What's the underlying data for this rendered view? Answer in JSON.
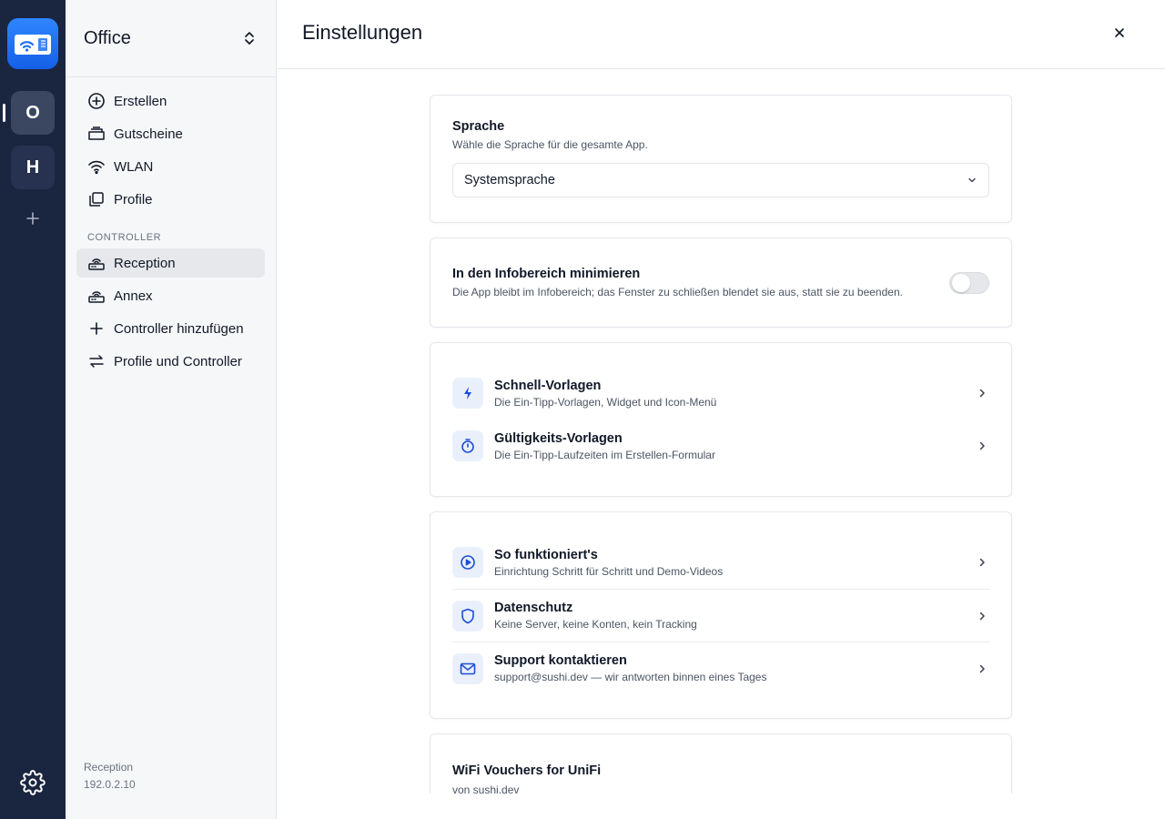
{
  "rail": {
    "workspaces": [
      {
        "letter": "O",
        "active": true
      },
      {
        "letter": "H",
        "active": false
      }
    ],
    "add_icon": "plus-icon",
    "settings_icon": "gear-icon",
    "logo_icon": "wifi-ticket-icon",
    "colors": {
      "background": "#1a2540",
      "logo": "#1f72f5"
    }
  },
  "sidebar": {
    "workspace_name": "Office",
    "nav": [
      {
        "label": "Erstellen",
        "icon": "plus-circle-icon"
      },
      {
        "label": "Gutscheine",
        "icon": "tickets-icon"
      },
      {
        "label": "WLAN",
        "icon": "wifi-icon"
      },
      {
        "label": "Profile",
        "icon": "copy-icon"
      }
    ],
    "controller_section_label": "CONTROLLER",
    "controllers": [
      {
        "label": "Reception",
        "icon": "router-icon",
        "active": true
      },
      {
        "label": "Annex",
        "icon": "router-icon",
        "active": false
      },
      {
        "label": "Controller hinzufügen",
        "icon": "plus-icon",
        "active": false
      },
      {
        "label": "Profile und Controller",
        "icon": "arrows-exchange-icon",
        "active": false
      }
    ],
    "footer": {
      "name": "Reception",
      "ip": "192.0.2.10"
    }
  },
  "main": {
    "title": "Einstellungen",
    "language": {
      "title": "Sprache",
      "subtitle": "Wähle die Sprache für die gesamte App.",
      "selected": "Systemsprache"
    },
    "tray": {
      "title": "In den Infobereich minimieren",
      "subtitle": "Die App bleibt im Infobereich; das Fenster zu schließen blendet sie aus, statt sie zu beenden.",
      "enabled": false
    },
    "templates": [
      {
        "title": "Schnell-Vorlagen",
        "subtitle": "Die Ein-Tipp-Vorlagen, Widget und Icon-Menü",
        "icon": "bolt-icon"
      },
      {
        "title": "Gültigkeits-Vorlagen",
        "subtitle": "Die Ein-Tipp-Laufzeiten im Erstellen-Formular",
        "icon": "stopwatch-icon"
      }
    ],
    "info": [
      {
        "title": "So funktioniert's",
        "subtitle": "Einrichtung Schritt für Schritt und Demo-Videos",
        "icon": "play-circle-icon"
      },
      {
        "title": "Datenschutz",
        "subtitle": "Keine Server, keine Konten, kein Tracking",
        "icon": "shield-icon"
      },
      {
        "title": "Support kontaktieren",
        "subtitle": "support@sushi.dev — wir antworten binnen eines Tages",
        "icon": "mail-icon"
      }
    ],
    "about": {
      "title": "WiFi Vouchers for UniFi",
      "subtitle": "von sushi.dev"
    },
    "accent": "#1d4ed8"
  }
}
